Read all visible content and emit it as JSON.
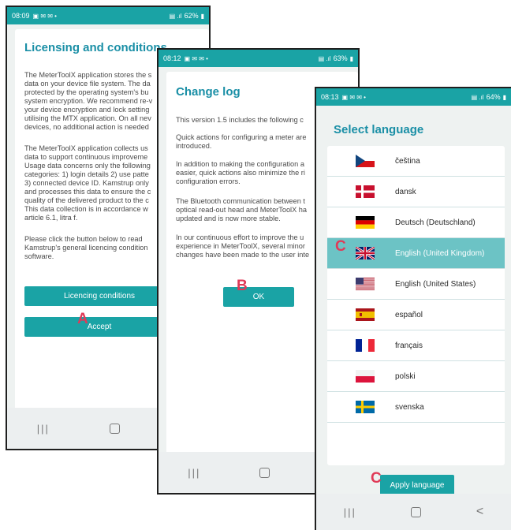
{
  "phone1": {
    "status_time": "08:09",
    "status_battery": "62%",
    "title": "Licensing and conditions",
    "paragraphs": [
      "The MeterToolX application stores the s\ndata on your device file system. The da\nprotected by the operating system's bu\nsystem encryption. We recommend re-v\nyour device encryption and lock setting\nutilising the MTX application. On all nev\ndevices, no additional action is needed",
      "The MeterToolX application collects us\ndata to support continuous improveme\nUsage data concerns only the following\ncategories: 1) login details 2) use patte\n3) connected device ID. Kamstrup only\nand processes this data to ensure the c\nquality of the delivered product to the c\nThis data collection is in accordance w\narticle 6.1, litra f.",
      "Please click the button below to read\nKamstrup's general licencing condition\nsoftware."
    ],
    "licencing_button": "Licencing conditions",
    "accept_button": "Accept",
    "marker": "A"
  },
  "phone2": {
    "status_time": "08:12",
    "status_battery": "63%",
    "title": "Change log",
    "paragraphs": [
      "This version 1.5 includes the following c",
      "Quick actions for configuring a meter are\nintroduced.",
      "In addition to making the configuration a\neasier, quick actions also minimize the ri\nconfiguration errors.",
      "The Bluetooth communication between t\noptical read-out head and MeterToolX ha\nupdated and is now more stable.",
      "In our continuous effort to improve the u\nexperience in MeterToolX, several minor\nchanges have been made to the user inte"
    ],
    "ok_button": "OK",
    "marker": "B"
  },
  "phone3": {
    "status_time": "08:13",
    "status_battery": "64%",
    "title": "Select language",
    "languages": [
      {
        "name": "čeština",
        "flag": "cz"
      },
      {
        "name": "dansk",
        "flag": "dk"
      },
      {
        "name": "Deutsch (Deutschland)",
        "flag": "de"
      },
      {
        "name": "English (United Kingdom)",
        "flag": "gb"
      },
      {
        "name": "English (United States)",
        "flag": "us"
      },
      {
        "name": "español",
        "flag": "es"
      },
      {
        "name": "français",
        "flag": "fr"
      },
      {
        "name": "polski",
        "flag": "pl"
      },
      {
        "name": "svenska",
        "flag": "se"
      }
    ],
    "selected": "English (United Kingdom)",
    "apply_button": "Apply language",
    "marker_row": "C",
    "marker_button": "C"
  },
  "colors": {
    "teal": "#1aa3a5",
    "selected_row": "#6cc3c5",
    "title": "#1a8fa6",
    "marker": "#e03a57"
  }
}
